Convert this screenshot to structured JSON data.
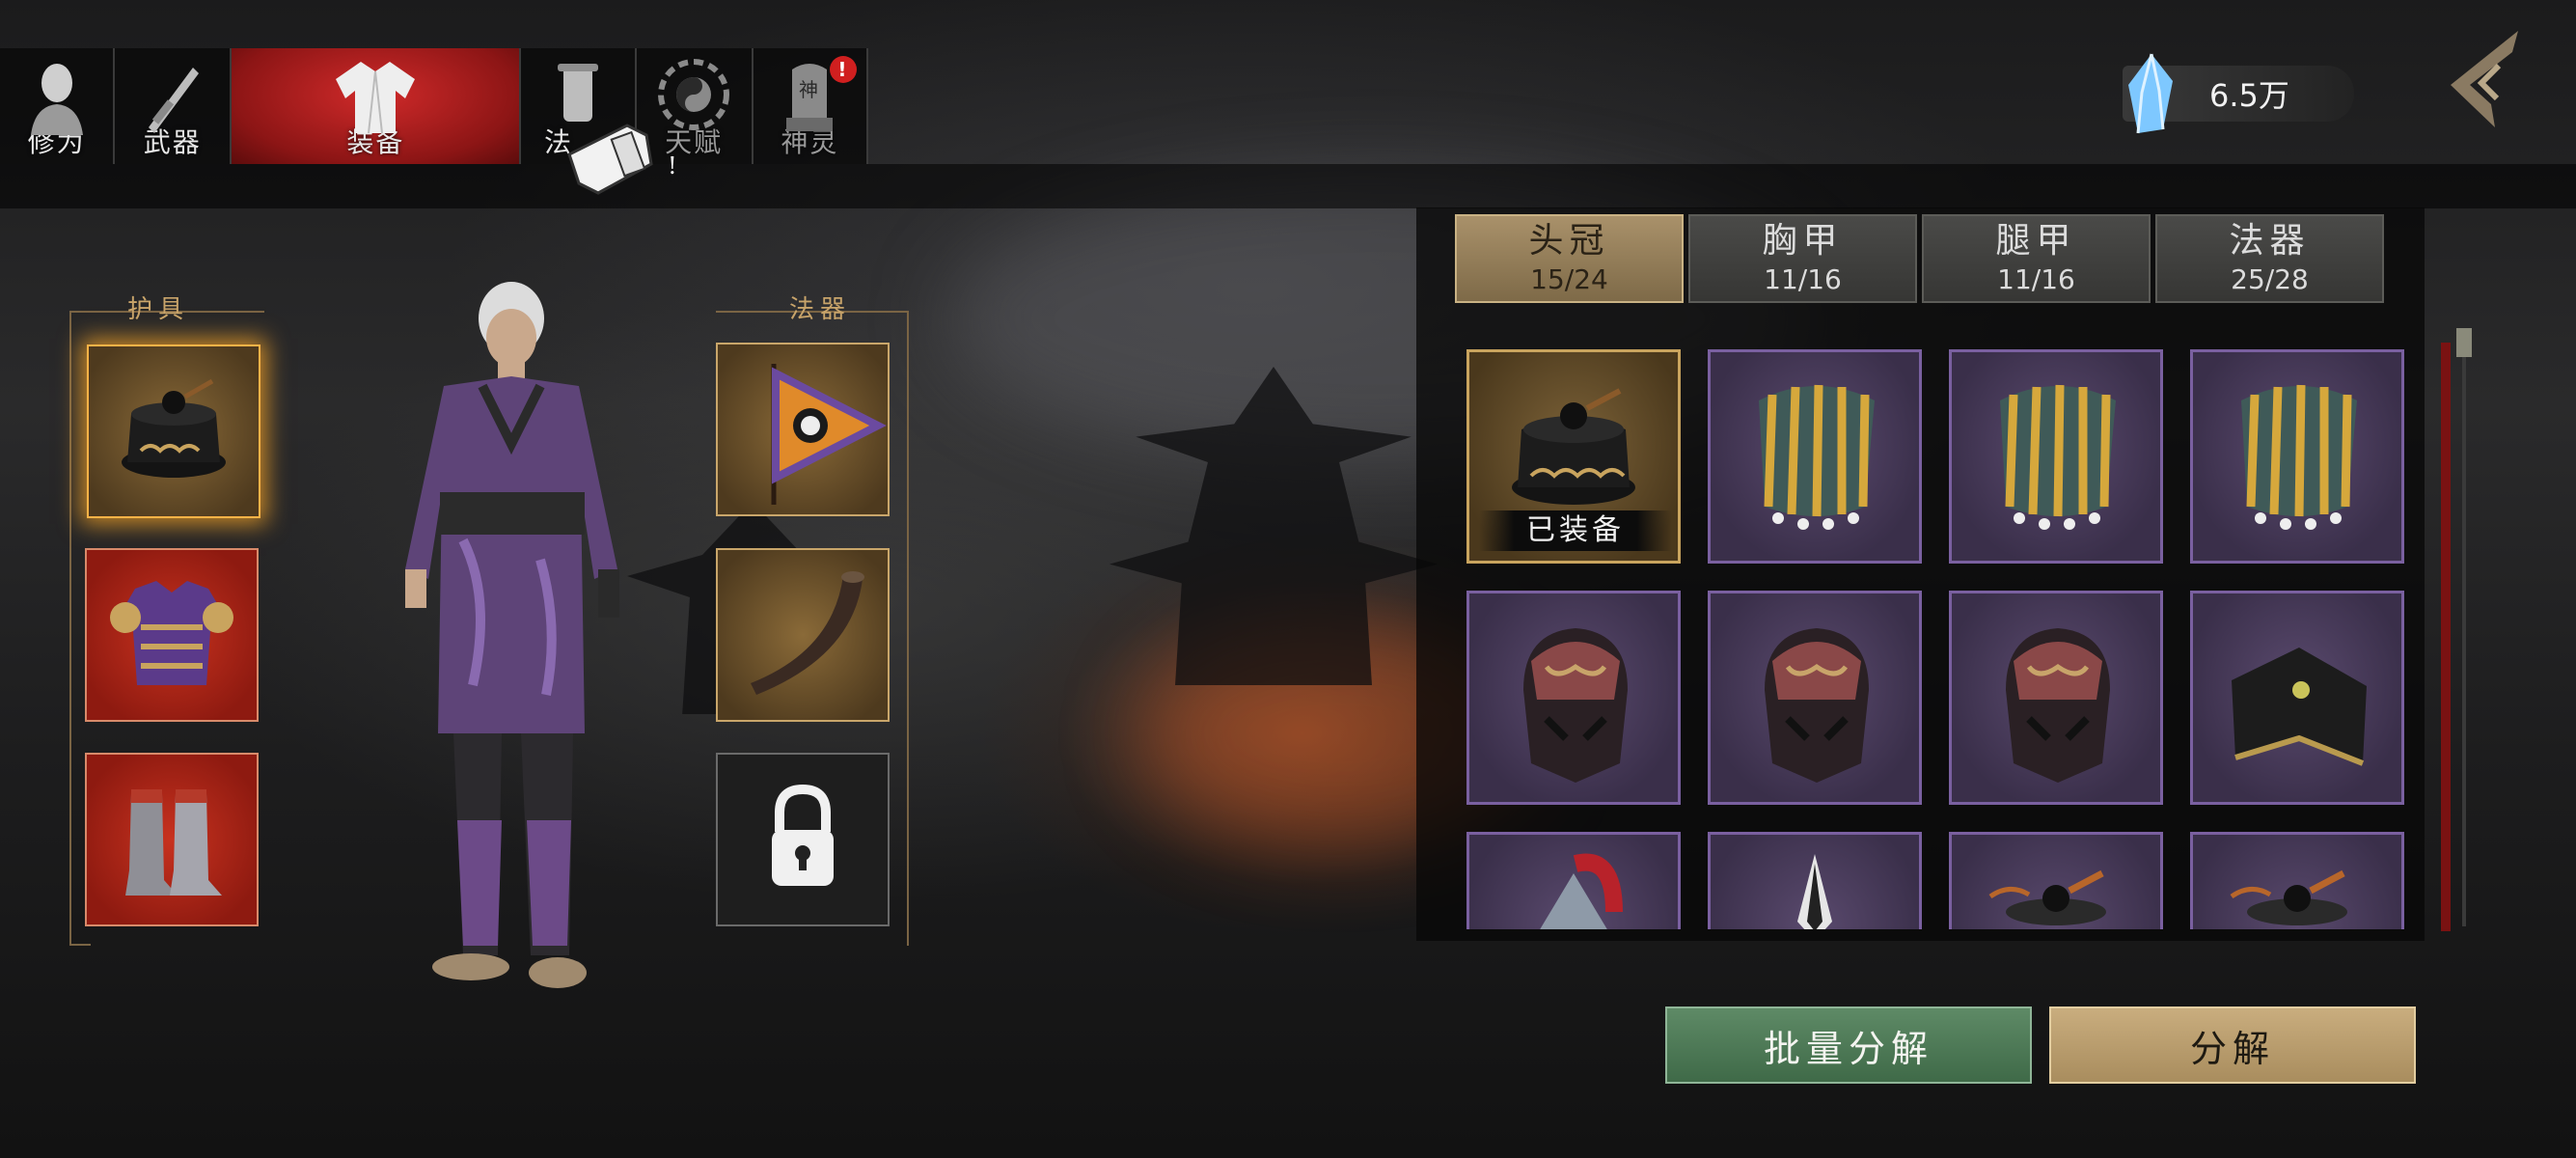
{
  "tabs": [
    {
      "label": "修为",
      "icon": "meditating-figure-icon",
      "active": false
    },
    {
      "label": "武器",
      "icon": "sword-icon",
      "active": false
    },
    {
      "label": "装备",
      "icon": "robe-icon",
      "active": true
    },
    {
      "label": "法",
      "icon": "scroll-icon",
      "active": false
    },
    {
      "label": "天赋",
      "icon": "bagua-icon",
      "active": false
    },
    {
      "label": "神灵",
      "icon": "shrine-tablet-icon",
      "active": false,
      "badge": "!"
    }
  ],
  "tab_overlay_mark": "!",
  "shrine_glyph": "神",
  "currency": {
    "value": "6.5万",
    "icon": "crystal-icon"
  },
  "back_icon": "back-arrow-icon",
  "equipment": {
    "armor_label": "护具",
    "artifact_label": "法器",
    "armor_slots": [
      {
        "icon": "crown-hat-icon",
        "selected": true
      },
      {
        "icon": "chest-armor-icon",
        "selected": false
      },
      {
        "icon": "boots-icon",
        "selected": false
      }
    ],
    "artifact_slots": [
      {
        "icon": "bagua-flag-icon",
        "locked": false
      },
      {
        "icon": "horn-icon",
        "locked": false
      },
      {
        "icon": "lock-icon",
        "locked": true
      }
    ]
  },
  "categories": [
    {
      "name": "头冠",
      "count": "15/24",
      "active": true
    },
    {
      "name": "胸甲",
      "count": "11/16",
      "active": false
    },
    {
      "name": "腿甲",
      "count": "11/16",
      "active": false
    },
    {
      "name": "法器",
      "count": "25/28",
      "active": false
    }
  ],
  "inventory": [
    {
      "icon": "crown-hat-icon",
      "rarity": "gold",
      "equipped": true
    },
    {
      "icon": "gold-shoulder-guard-icon",
      "rarity": "purple"
    },
    {
      "icon": "gold-shoulder-guard-icon",
      "rarity": "purple"
    },
    {
      "icon": "gold-shoulder-guard-icon",
      "rarity": "purple"
    },
    {
      "icon": "demon-helmet-icon",
      "rarity": "purple"
    },
    {
      "icon": "demon-helmet-icon",
      "rarity": "purple"
    },
    {
      "icon": "demon-helmet-icon",
      "rarity": "purple"
    },
    {
      "icon": "black-scholar-hat-icon",
      "rarity": "purple"
    },
    {
      "icon": "plumed-helmet-icon",
      "rarity": "purple"
    },
    {
      "icon": "spike-helmet-icon",
      "rarity": "purple"
    },
    {
      "icon": "crown-hat-icon",
      "rarity": "purple"
    },
    {
      "icon": "crown-hat-icon",
      "rarity": "purple"
    }
  ],
  "equipped_label": "已装备",
  "buttons": {
    "batch_decompose": "批量分解",
    "decompose": "分解"
  },
  "colors": {
    "active_tab": "#b81d1d",
    "gold_frame": "#c9a66a",
    "purple_frame": "#7a60a0",
    "batch_button": "#4f7a58",
    "decompose_button": "#b99d6e"
  }
}
